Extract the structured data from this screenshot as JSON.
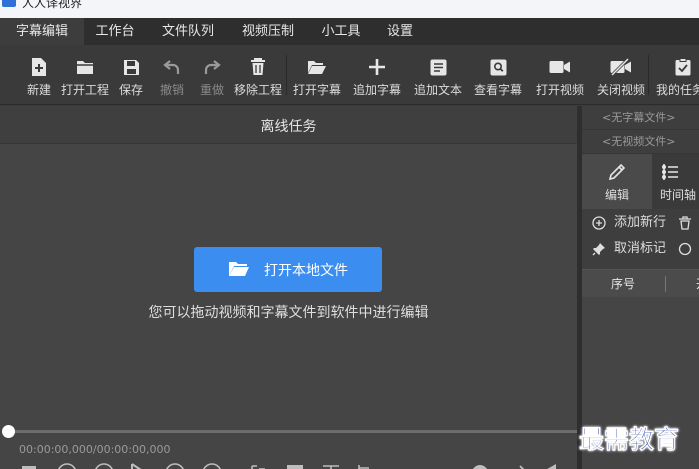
{
  "titlebar": {
    "title": "人人译视界"
  },
  "menu": {
    "items": [
      {
        "label": "字幕编辑",
        "active": true
      },
      {
        "label": "工作台"
      },
      {
        "label": "文件队列"
      },
      {
        "label": "视频压制"
      },
      {
        "label": "小工具"
      },
      {
        "label": "设置"
      }
    ]
  },
  "toolbar": {
    "items": [
      {
        "label": "新建",
        "icon": "new-file-icon"
      },
      {
        "label": "打开工程",
        "icon": "folder-icon"
      },
      {
        "label": "保存",
        "icon": "save-icon"
      },
      {
        "label": "撤销",
        "icon": "undo-icon",
        "disabled": true
      },
      {
        "label": "重做",
        "icon": "redo-icon",
        "disabled": true
      },
      {
        "label": "移除工程",
        "icon": "trash-icon"
      },
      {
        "label": "打开字幕",
        "icon": "open-folder-icon"
      },
      {
        "label": "追加字幕",
        "icon": "plus-icon"
      },
      {
        "label": "追加文本",
        "icon": "text-doc-icon"
      },
      {
        "label": "查看字幕",
        "icon": "view-subtitle-icon"
      },
      {
        "label": "打开视频",
        "icon": "video-camera-icon"
      },
      {
        "label": "关闭视频",
        "icon": "video-off-icon"
      },
      {
        "label": "我的任务",
        "icon": "task-icon"
      }
    ]
  },
  "main": {
    "title": "离线任务",
    "open_button": "打开本地文件",
    "hint": "您可以拖动视频和字幕文件到软件中进行编辑",
    "timecode": "00:00:00,000/00:00:00,000"
  },
  "right_panel": {
    "subtitle_file": "<无字幕文件>",
    "video_file": "<无视频文件>",
    "tabs": [
      {
        "label": "编辑",
        "icon": "pencil-icon",
        "active": true
      },
      {
        "label": "时间轴",
        "icon": "timeline-icon"
      }
    ],
    "actions": {
      "add_row": "添加新行",
      "cancel_mark": "取消标记"
    },
    "table": {
      "columns": [
        "序号",
        "开"
      ]
    }
  },
  "watermark": "最需教育",
  "colors": {
    "accent": "#3b8ef0",
    "menubar": "#2e2e2e",
    "toolbar": "#3a3a3a",
    "main_bg": "#454545"
  }
}
